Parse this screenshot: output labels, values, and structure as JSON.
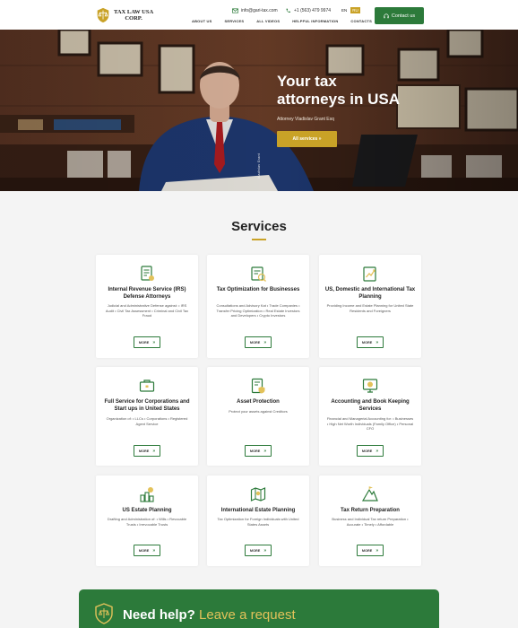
{
  "header": {
    "logo_line1": "TAX LAW USA",
    "logo_line2": "CORP.",
    "email": "info@gari-tax.com",
    "phone": "+1 (563) 479 9974",
    "lang_en": "EN",
    "lang_ru": "RU",
    "contact_btn": "Contact us",
    "nav": [
      "ABOUT US",
      "SERVICES",
      "ALL VIDEOS",
      "HELPFUL INFORMATION",
      "CONTACTS"
    ]
  },
  "hero": {
    "title_line1": "Your tax",
    "title_line2": "attorneys in USA",
    "subtitle": "Attorney Vladislav Grant Esq",
    "button": "All services",
    "vertical_text": "Vladislav Grant"
  },
  "services": {
    "title": "Services",
    "more_label": "MORE",
    "cards": [
      {
        "title": "Internal Revenue Service (IRS) Defense Attorneys",
        "desc": "Judicial and Administrative Defense against: • IRS Audit • Civil Tax Assessment • Criminal and Civil Tax Fraud",
        "icon": "document-check-icon"
      },
      {
        "title": "Tax Optimization for Businesses",
        "desc": "Consultations and Advisory Kat • Trade Companies • Transfer Pricing Optimization • Real Estate Investors and Developers • Crypto Investors",
        "icon": "tax-document-icon"
      },
      {
        "title": "US, Domestic and International Tax Planning",
        "desc": "Providing Income and Estate Planning for United State Residents and Foreigners",
        "icon": "growth-chart-icon"
      },
      {
        "title": "Full Service for Corporations and Start ups in United States",
        "desc": "Organization of: • LLCs • Corporations • Registered Agent Service",
        "icon": "briefcase-icon"
      },
      {
        "title": "Asset Protection",
        "desc": "Protect your assets against Creditors",
        "icon": "shield-document-icon"
      },
      {
        "title": "Accounting and Book Keeping Services",
        "desc": "Financial and Managerial Accounting for: • Businesses • High Net Worth Individuals (Family Office) • Personal CFO",
        "icon": "money-screen-icon"
      },
      {
        "title": "US Estate Planning",
        "desc": "Drafting and Administration of: • Wills • Revocable Trusts • Irrevocable Trusts",
        "icon": "coins-icon"
      },
      {
        "title": "International Estate Planning",
        "desc": "Tax Optimization for Foreign Individuals with United States Assets",
        "icon": "map-icon"
      },
      {
        "title": "Tax Return Preparation",
        "desc": "Business and Individual Tax return Preparation • Accurate • Timely • Affordable",
        "icon": "mountain-icon"
      }
    ]
  },
  "help": {
    "text_white": "Need help?",
    "text_gold": "Leave a request"
  },
  "colors": {
    "primary_green": "#2c7a3a",
    "gold": "#c9a227"
  }
}
